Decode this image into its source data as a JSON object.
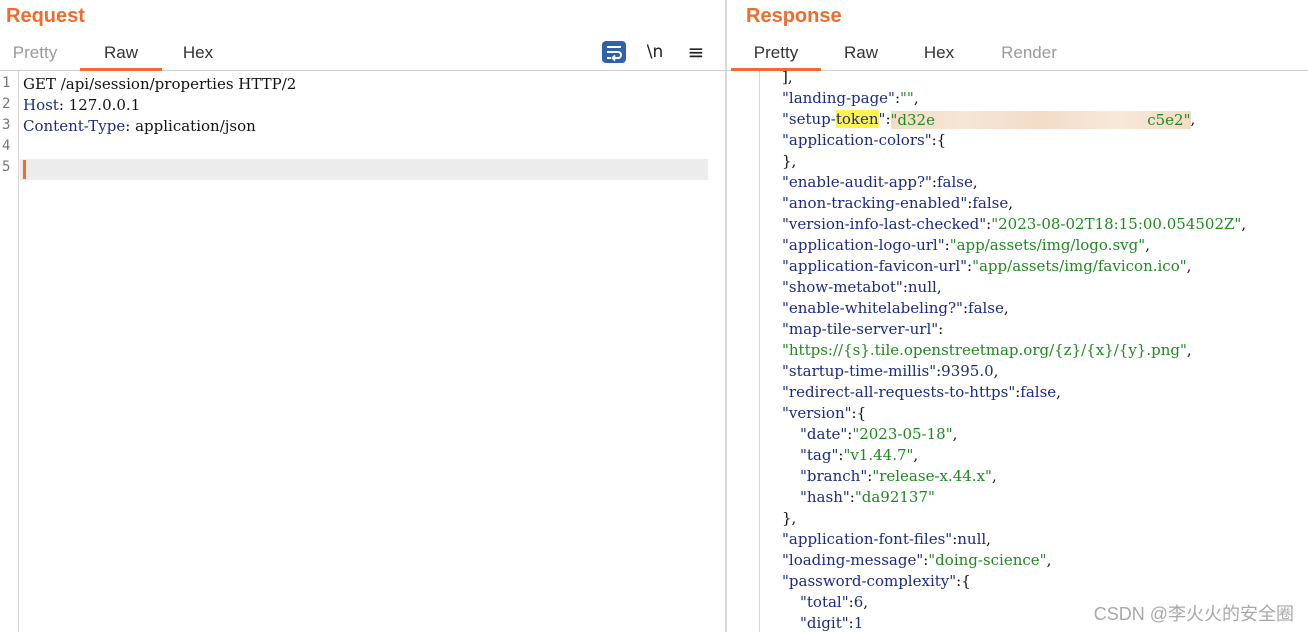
{
  "request": {
    "title": "Request",
    "tabs": [
      "Pretty",
      "Raw",
      "Hex"
    ],
    "tools": {
      "wrap_icon": "word-wrap-icon",
      "newline_label": "\\n",
      "menu_label": "≡"
    },
    "line_numbers": [
      "1",
      "2",
      "3",
      "4",
      "5"
    ],
    "lines": {
      "l1": "GET /api/session/properties HTTP/2",
      "l2_key": "Host",
      "l2_val": " 127.0.0.1",
      "l3_key": "Content-Type",
      "l3_val": " application/json"
    }
  },
  "response": {
    "title": "Response",
    "tabs": [
      "Pretty",
      "Raw",
      "Hex",
      "Render"
    ],
    "lines": {
      "r0": "],",
      "r1_key": "\"landing-page\"",
      "r1_val": "\"\"",
      "r2_key_a": "\"setup-",
      "r2_key_hl": "token",
      "r2_key_b": "\"",
      "r2_val_start": "\"d32e",
      "r2_val_end": "c5e2\"",
      "r3_key": "\"application-colors\"",
      "r3_rest": ":{",
      "r4": "},",
      "r5_key": "\"enable-audit-app?\"",
      "r5_val": "false",
      "r6_key": "\"anon-tracking-enabled\"",
      "r6_val": "false",
      "r7_key": "\"version-info-last-checked\"",
      "r7_val": "\"2023-08-02T18:15:00.054502Z\"",
      "r8_key": "\"application-logo-url\"",
      "r8_val": "\"app/assets/img/logo.svg\"",
      "r9_key": "\"application-favicon-url\"",
      "r9_val": "\"app/assets/img/favicon.ico\"",
      "r10_key": "\"show-metabot\"",
      "r10_val": "null",
      "r11_key": "\"enable-whitelabeling?\"",
      "r11_val": "false",
      "r12_key": "\"map-tile-server-url\"",
      "r13_val": "\"https://{s}.tile.openstreetmap.org/{z}/{x}/{y}.png\"",
      "r14_key": "\"startup-time-millis\"",
      "r14_val": "9395.0",
      "r15_key": "\"redirect-all-requests-to-https\"",
      "r15_val": "false",
      "r16_key": "\"version\"",
      "r17_key": "\"date\"",
      "r17_val": "\"2023-05-18\"",
      "r18_key": "\"tag\"",
      "r18_val": "\"v1.44.7\"",
      "r19_key": "\"branch\"",
      "r19_val": "\"release-x.44.x\"",
      "r20_key": "\"hash\"",
      "r20_val": "\"da92137\"",
      "r21": "},",
      "r22_key": "\"application-font-files\"",
      "r22_val": "null",
      "r23_key": "\"loading-message\"",
      "r23_val": "\"doing-science\"",
      "r24_key": "\"password-complexity\"",
      "r25_key": "\"total\"",
      "r25_val": "6",
      "r26_key": "\"digit\"",
      "r26_val": "1"
    }
  },
  "watermark": "CSDN @李火火的安全圈",
  "colors": {
    "accent": "#f06b2c",
    "key": "#1b2a88",
    "string": "#1e8a1e",
    "highlight": "#fff44f"
  }
}
